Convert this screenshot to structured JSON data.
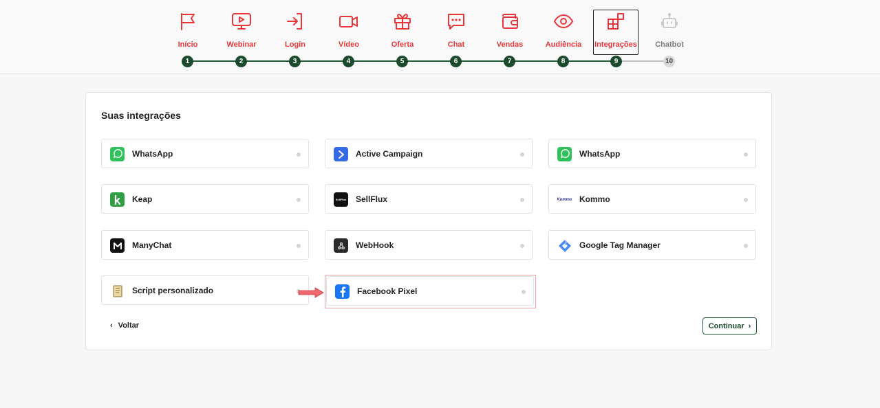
{
  "steps": [
    {
      "label": "Início",
      "num": "1",
      "icon": "flag-icon"
    },
    {
      "label": "Webinar",
      "num": "2",
      "icon": "monitor-play-icon"
    },
    {
      "label": "Login",
      "num": "3",
      "icon": "login-icon"
    },
    {
      "label": "Vídeo",
      "num": "4",
      "icon": "video-camera-icon"
    },
    {
      "label": "Oferta",
      "num": "5",
      "icon": "gift-icon"
    },
    {
      "label": "Chat",
      "num": "6",
      "icon": "chat-bubble-icon"
    },
    {
      "label": "Vendas",
      "num": "7",
      "icon": "wallet-icon"
    },
    {
      "label": "Audiência",
      "num": "8",
      "icon": "eye-icon"
    },
    {
      "label": "Integrações",
      "num": "9",
      "icon": "widgets-icon"
    },
    {
      "label": "Chatbot",
      "num": "10",
      "icon": "robot-icon"
    }
  ],
  "active_step": "Integrações",
  "card": {
    "title": "Suas integrações",
    "integrations": [
      {
        "name": "WhatsApp",
        "icon": "whatsapp-icon"
      },
      {
        "name": "Active Campaign",
        "icon": "active-campaign-icon"
      },
      {
        "name": "WhatsApp",
        "icon": "whatsapp-icon"
      },
      {
        "name": "Keap",
        "icon": "keap-icon"
      },
      {
        "name": "SellFlux",
        "icon": "sellflux-icon",
        "logo_text": "SellFlux"
      },
      {
        "name": "Kommo",
        "icon": "kommo-icon",
        "logo_text": "Kommo"
      },
      {
        "name": "ManyChat",
        "icon": "manychat-icon"
      },
      {
        "name": "WebHook",
        "icon": "webhook-icon"
      },
      {
        "name": "Google Tag Manager",
        "icon": "google-tag-manager-icon"
      },
      {
        "name": "Script personalizado",
        "icon": "script-icon"
      },
      {
        "name": "Facebook Pixel",
        "icon": "facebook-icon"
      }
    ],
    "back_label": "Voltar",
    "continue_label": "Continuar"
  },
  "colors": {
    "accent_red": "#e8363a",
    "step_green": "#1c4a2c",
    "highlight": "#f0a0a4"
  }
}
